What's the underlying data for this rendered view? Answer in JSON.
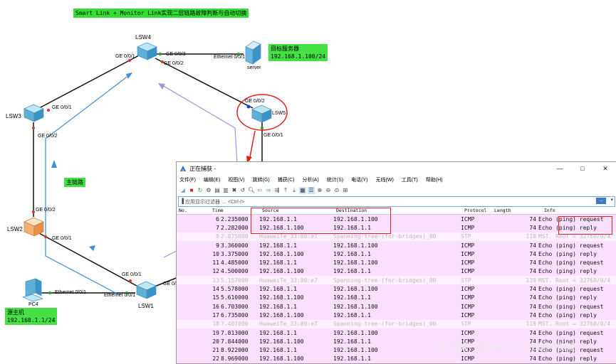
{
  "topology": {
    "title": "Smart Link + Monitor Link实现二层链路故障判断与自动切换",
    "devices": {
      "lsw4": "LSW4",
      "lsw3": "LSW3",
      "lsw2": "LSW2",
      "lsw1": "LSW1",
      "lsw5": "LSW5",
      "server": "server",
      "pc4": "PC4"
    },
    "ports": {
      "lsw4_left": "GE 0/0/1",
      "lsw4_right": "GE 0/0/3",
      "lsw4_bottom": "GE 0/0/2",
      "server_eth": "Ethernet 0/0/1",
      "lsw3_top": "GE 0/0/1",
      "lsw3_bottom": "GE 0/0/2",
      "lsw2_top": "GE 0/0/2",
      "lsw2_bottom": "GE 0/0/1",
      "lsw1_top": "GE 0/0/1",
      "lsw1_right": "GE 0/",
      "lsw1_left": "Ethernet 0/0/1",
      "pc4_eth": "Ethernet 0/0/1",
      "lsw5_top": "GE 0/0/2",
      "lsw5_bottom": "GE 0/0/1"
    },
    "server_box": {
      "line1": "目标服务器",
      "line2": "192.168.1.100/24"
    },
    "host_box": {
      "line1": "源主机",
      "line2": "192.168.1.1/24"
    },
    "main_link_label": "主链路",
    "watermark": "CSDN @weixin_46074962"
  },
  "wireshark": {
    "title": "正在捕获 -",
    "win_buttons": [
      "—",
      "□",
      "✕"
    ],
    "menu": [
      "文件(F)",
      "编辑(E)",
      "视图(V)",
      "跳转(G)",
      "捕获(C)",
      "分析(A)",
      "统计(S)",
      "电话(Y)",
      "无线(W)",
      "工具(T)",
      "帮助(H)"
    ],
    "filter_placeholder": "应用显示过滤器 … <Ctrl-/>",
    "columns": [
      "No.",
      "Time",
      "Source",
      "Destination",
      "Protocol",
      "Length",
      "Info"
    ],
    "rows": [
      {
        "no": "6",
        "time": "2.235000",
        "src": "192.168.1.1",
        "dst": "192.168.1.100",
        "proto": "ICMP",
        "len": "74",
        "info": "Echo (ping) request",
        "kind": "icmp"
      },
      {
        "no": "7",
        "time": "2.282000",
        "src": "192.168.1.100",
        "dst": "192.168.1.1",
        "proto": "ICMP",
        "len": "74",
        "info": "Echo (ping) reply",
        "kind": "icmp"
      },
      {
        "no": "8",
        "time": "2.875000",
        "src": "HuaweiTe_33:80:e7",
        "dst": "Spanning-tree-(for-bridges)_00",
        "proto": "STP",
        "len": "119",
        "info": "MST. Root = 32768/0/4",
        "kind": "stp"
      },
      {
        "no": "9",
        "time": "3.360000",
        "src": "192.168.1.1",
        "dst": "192.168.1.100",
        "proto": "ICMP",
        "len": "74",
        "info": "Echo (ping) request",
        "kind": "icmp"
      },
      {
        "no": "10",
        "time": "3.375000",
        "src": "192.168.1.100",
        "dst": "192.168.1.1",
        "proto": "ICMP",
        "len": "74",
        "info": "Echo (ping) reply",
        "kind": "icmp"
      },
      {
        "no": "11",
        "time": "4.485000",
        "src": "192.168.1.1",
        "dst": "192.168.1.100",
        "proto": "ICMP",
        "len": "74",
        "info": "Echo (ping) request",
        "kind": "icmp"
      },
      {
        "no": "12",
        "time": "4.500000",
        "src": "192.168.1.100",
        "dst": "192.168.1.1",
        "proto": "ICMP",
        "len": "74",
        "info": "Echo (ping) reply",
        "kind": "icmp"
      },
      {
        "no": "13",
        "time": "5.157000",
        "src": "HuaweiTe_33:80:e7",
        "dst": "Spanning-tree-(for-bridges)_00",
        "proto": "STP",
        "len": "119",
        "info": "MST. Root = 32768/0/4",
        "kind": "stp"
      },
      {
        "no": "14",
        "time": "5.578000",
        "src": "192.168.1.1",
        "dst": "192.168.1.100",
        "proto": "ICMP",
        "len": "74",
        "info": "Echo (ping) request",
        "kind": "icmp"
      },
      {
        "no": "15",
        "time": "5.610000",
        "src": "192.168.1.100",
        "dst": "192.168.1.1",
        "proto": "ICMP",
        "len": "74",
        "info": "Echo (ping) reply",
        "kind": "icmp"
      },
      {
        "no": "16",
        "time": "6.703000",
        "src": "192.168.1.1",
        "dst": "192.168.1.100",
        "proto": "ICMP",
        "len": "74",
        "info": "Echo (ping) request",
        "kind": "icmp"
      },
      {
        "no": "17",
        "time": "6.735000",
        "src": "192.168.1.100",
        "dst": "192.168.1.1",
        "proto": "ICMP",
        "len": "74",
        "info": "Echo (ping) reply",
        "kind": "icmp"
      },
      {
        "no": "18",
        "time": "7.407000",
        "src": "HuaweiTe_33:80:e7",
        "dst": "Spanning-tree-(for-bridges)_00",
        "proto": "STP",
        "len": "119",
        "info": "MST. Root = 32768/0/4",
        "kind": "stp"
      },
      {
        "no": "19",
        "time": "7.813000",
        "src": "192.168.1.1",
        "dst": "192.168.1.100",
        "proto": "ICMP",
        "len": "74",
        "info": "Echo (ping) request",
        "kind": "icmp"
      },
      {
        "no": "20",
        "time": "7.844000",
        "src": "192.168.1.100",
        "dst": "192.168.1.1",
        "proto": "ICMP",
        "len": "74",
        "info": "Echo (ping) reply",
        "kind": "icmp"
      },
      {
        "no": "21",
        "time": "8.922000",
        "src": "192.168.1.1",
        "dst": "192.168.1.100",
        "proto": "ICMP",
        "len": "74",
        "info": "Echo (ping) request",
        "kind": "icmp"
      },
      {
        "no": "22",
        "time": "8.969000",
        "src": "192.168.1.100",
        "dst": "192.168.1.1",
        "proto": "ICMP",
        "len": "74",
        "info": "Echo (ping) reply",
        "kind": "icmp"
      }
    ]
  },
  "colors": {
    "icmp_row": "#fce0ff",
    "stp_row": "#fff0ff",
    "highlight": "#e02020",
    "main_link": "#3a8fe0"
  }
}
